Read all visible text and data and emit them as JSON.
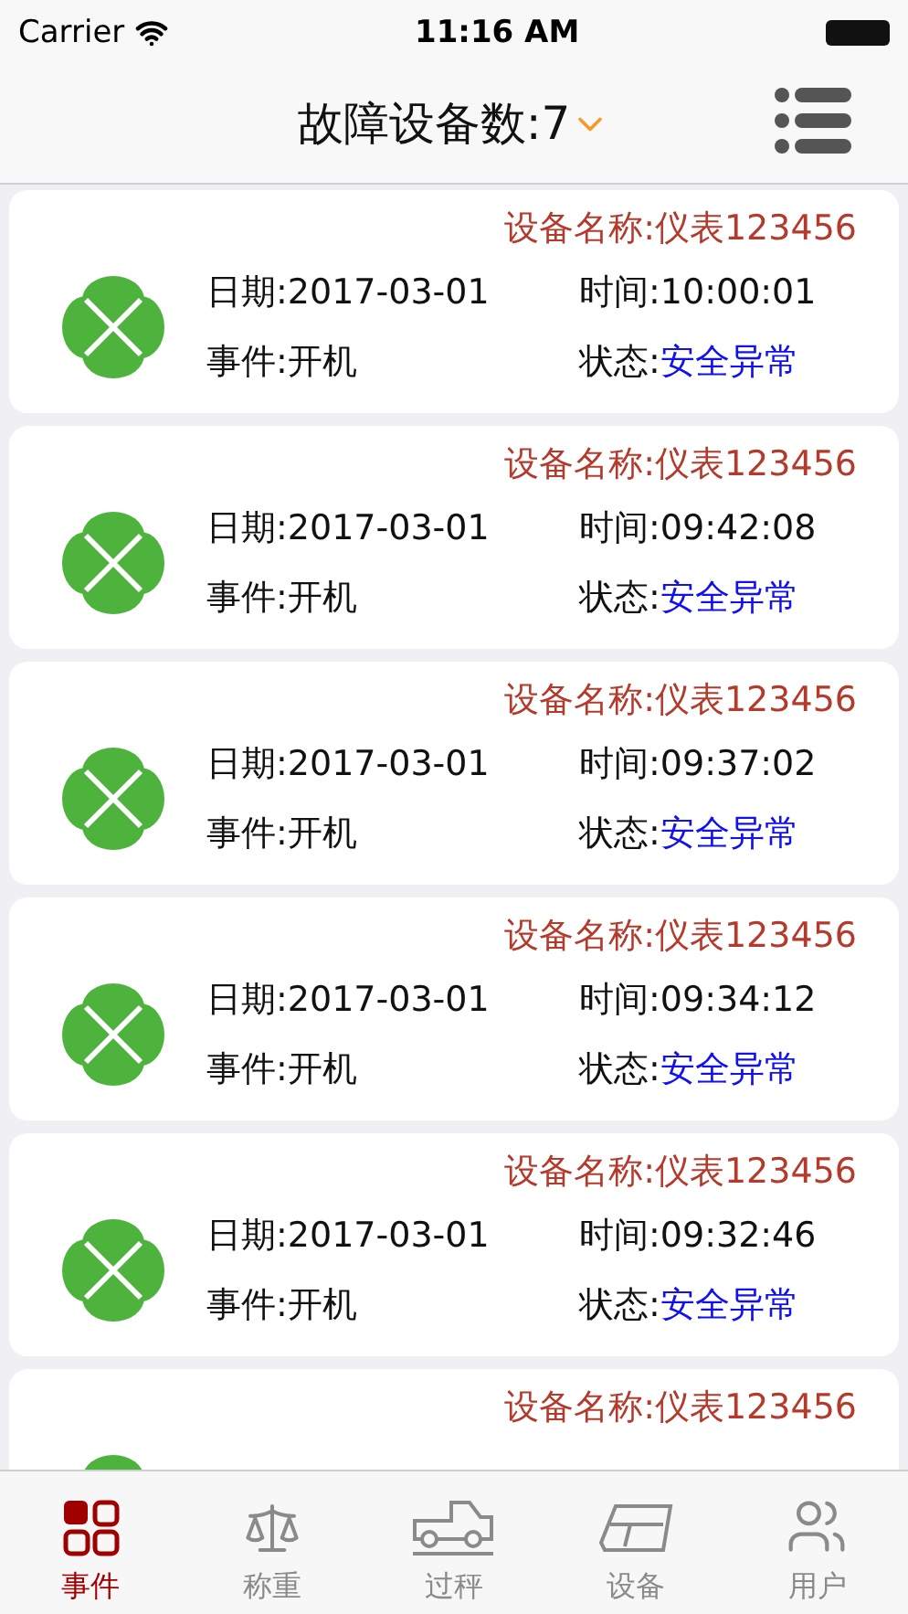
{
  "status_bar": {
    "carrier": "Carrier",
    "time": "11:16 AM"
  },
  "nav": {
    "title": "故障设备数:7"
  },
  "events": [
    {
      "name": "设备名称:仪表123456",
      "date": "日期:2017-03-01",
      "time": "时间:10:00:01",
      "event": "事件:开机",
      "status_label": "状态:",
      "status": "安全异常"
    },
    {
      "name": "设备名称:仪表123456",
      "date": "日期:2017-03-01",
      "time": "时间:09:42:08",
      "event": "事件:开机",
      "status_label": "状态:",
      "status": "安全异常"
    },
    {
      "name": "设备名称:仪表123456",
      "date": "日期:2017-03-01",
      "time": "时间:09:37:02",
      "event": "事件:开机",
      "status_label": "状态:",
      "status": "安全异常"
    },
    {
      "name": "设备名称:仪表123456",
      "date": "日期:2017-03-01",
      "time": "时间:09:34:12",
      "event": "事件:开机",
      "status_label": "状态:",
      "status": "安全异常"
    },
    {
      "name": "设备名称:仪表123456",
      "date": "日期:2017-03-01",
      "time": "时间:09:32:46",
      "event": "事件:开机",
      "status_label": "状态:",
      "status": "安全异常"
    },
    {
      "name": "设备名称:仪表123456"
    }
  ],
  "tabs": [
    {
      "kind": "grid",
      "label": "事件",
      "selected": true
    },
    {
      "kind": "scale",
      "label": "称重",
      "selected": false
    },
    {
      "kind": "truck",
      "label": "过秤",
      "selected": false
    },
    {
      "kind": "device",
      "label": "设备",
      "selected": false
    },
    {
      "kind": "users",
      "label": "用户",
      "selected": false
    }
  ]
}
